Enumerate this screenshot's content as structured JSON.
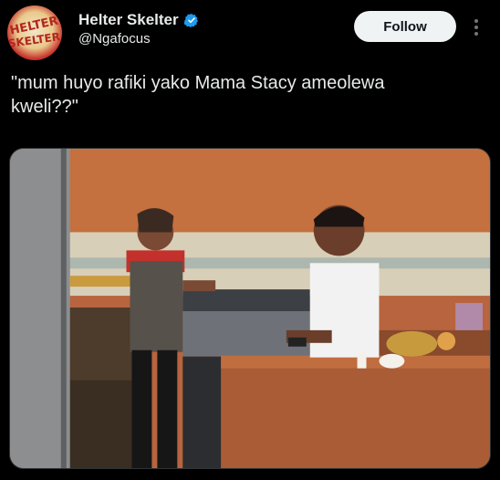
{
  "header": {
    "display_name": "Helter Skelter",
    "handle": "@Ngafocus",
    "follow_label": "Follow",
    "avatar_logo_text": "HELTER SKELTER",
    "verified_icon": "verified-badge-icon",
    "more_icon": "more-vertical-icon"
  },
  "tweet": {
    "text": "\"mum huyo rafiki yako Mama Stacy ameolewa\nkweli??\""
  },
  "media": {
    "description_icon": "kitchen-photo"
  },
  "colors": {
    "background": "#000000",
    "text": "#e7e9ea",
    "follow_bg": "#eff3f4",
    "verified": "#1d9bf0"
  }
}
